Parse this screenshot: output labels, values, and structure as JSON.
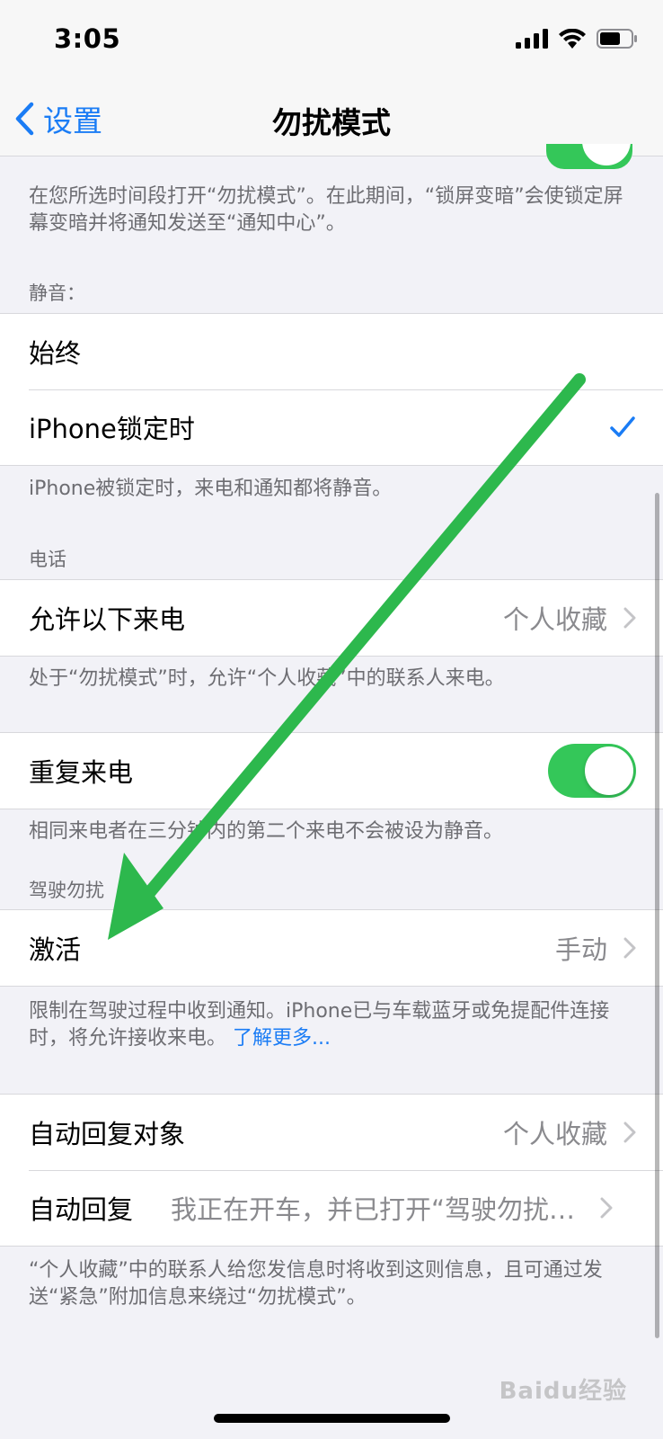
{
  "status_bar": {
    "time": "3:05"
  },
  "nav": {
    "back_label": "设置",
    "title": "勿扰模式"
  },
  "top_footer": "在您所选时间段打开“勿扰模式”。在此期间，“锁屏变暗”会使锁定屏幕变暗并将通知发送至“通知中心”。",
  "silence": {
    "header": "静音：",
    "options": [
      {
        "label": "始终",
        "selected": false
      },
      {
        "label": "iPhone锁定时",
        "selected": true
      }
    ],
    "footer": "iPhone被锁定时，来电和通知都将静音。"
  },
  "phone": {
    "header": "电话",
    "allow_calls_label": "允许以下来电",
    "allow_calls_value": "个人收藏",
    "footer": "处于“勿扰模式”时，允许“个人收藏”中的联系人来电。"
  },
  "repeated_calls": {
    "label": "重复来电",
    "enabled": true,
    "footer": "相同来电者在三分钟内的第二个来电不会被设为静音。"
  },
  "driving": {
    "header": "驾驶勿扰",
    "activate_label": "激活",
    "activate_value": "手动",
    "footer": "限制在驾驶过程中收到通知。iPhone已与车载蓝牙或免提配件连接时，将允许接收来电。",
    "learn_more": "了解更多..."
  },
  "auto_reply": {
    "to_label": "自动回复对象",
    "to_value": "个人收藏",
    "reply_label": "自动回复",
    "reply_value": "我正在开车，并已打开“驾驶勿扰模式”",
    "footer": "“个人收藏”中的联系人给您发信息时将收到这则信息，且可通过发送“紧急”附加信息来绕过“勿扰模式”。"
  },
  "watermark": "Baidu经验",
  "colors": {
    "accent": "#1a7cf5",
    "toggle_on": "#34c759",
    "annotation_arrow": "#2db84d"
  }
}
